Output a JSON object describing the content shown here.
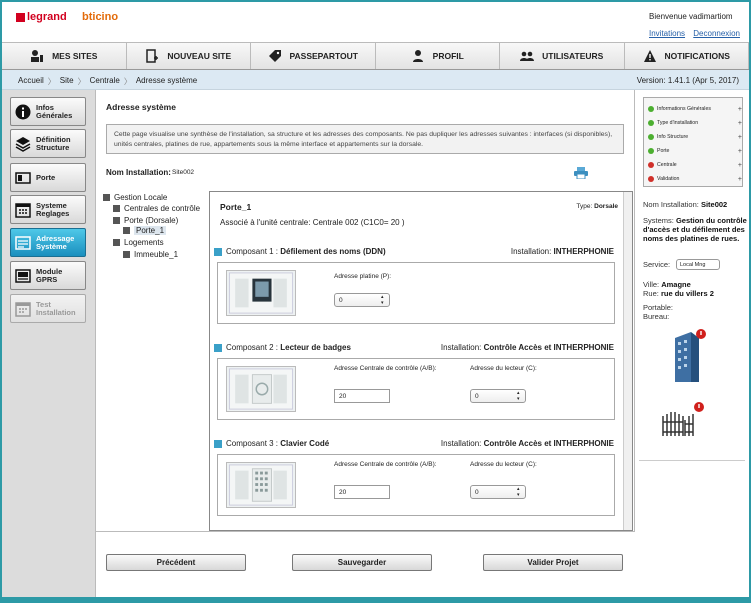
{
  "header": {
    "welcome": "Bienvenue vadimartiom",
    "invitations": "Invitations",
    "deconnexion": "Deconnexion",
    "brand1": "legrand",
    "brand2": "bticino"
  },
  "nav": [
    {
      "label": "MES SITES",
      "icon": "user-sites-icon"
    },
    {
      "label": "NOUVEAU SITE",
      "icon": "new-site-icon"
    },
    {
      "label": "PASSEPARTOUT",
      "icon": "tag-icon"
    },
    {
      "label": "PROFIL",
      "icon": "profile-icon"
    },
    {
      "label": "UTILISATEURS",
      "icon": "users-icon"
    },
    {
      "label": "NOTIFICATIONS",
      "icon": "warning-icon"
    }
  ],
  "breadcrumb": [
    "Accueil",
    "Site",
    "Centrale",
    "Adresse système"
  ],
  "version": "Version: 1.41.1 (Apr 5, 2017)",
  "sidebar": [
    {
      "label": "Infos Générales",
      "icon": "info-icon"
    },
    {
      "label": "Définition Structure",
      "icon": "layers-icon"
    },
    {
      "label": "Porte",
      "icon": "door-icon"
    },
    {
      "label": "Systeme Reglages",
      "icon": "calendar-icon"
    },
    {
      "label": "Adressage Système",
      "icon": "address-icon",
      "active": true
    },
    {
      "label": "Module GPRS",
      "icon": "gprs-icon"
    },
    {
      "label": "Test Installation",
      "icon": "test-icon",
      "disabled": true
    }
  ],
  "main": {
    "title": "Adresse système",
    "info": "Cette page visualise une synthèse de l'installation, sa structure et les adresses des composants. Ne pas dupliquer les adresses suivantes : interfaces (si disponibles), unités centrales, platines de rue, appartements sous la même interface et appartements sur la dorsale.",
    "nom_label": "Nom Installation:",
    "nom_value": "Site002"
  },
  "tree": [
    {
      "label": "Gestion Locale"
    },
    {
      "label": "Centrales de contrôle"
    },
    {
      "label": "Porte (Dorsale)"
    },
    {
      "label": "Porte_1"
    },
    {
      "label": "Logements"
    },
    {
      "label": "Immeuble_1"
    }
  ],
  "detail": {
    "name": "Porte_1",
    "type_label": "Type:",
    "type_value": "Dorsale",
    "assoc": "Associé à l'unité centrale: Centrale 002 (C1C0= 20 )",
    "components": [
      {
        "title": "Composant 1 :",
        "name": "Défilement des noms (DDN)",
        "inst_label": "Installation:",
        "inst_value": "INTHERPHONIE",
        "f1_label": "Adresse platine (P):",
        "f1_value": "0"
      },
      {
        "title": "Composant 2 :",
        "name": "Lecteur de badges",
        "inst_label": "Installation:",
        "inst_value": "Contrôle Accès et INTHERPHONIE",
        "f1_label": "Adresse Centrale de contrôle (A/B):",
        "f1_value": "20",
        "f2_label": "Adresse du lecteur (C):",
        "f2_value": "0"
      },
      {
        "title": "Composant 3 :",
        "name": "Clavier Codé",
        "inst_label": "Installation:",
        "inst_value": "Contrôle Accès et INTHERPHONIE",
        "f1_label": "Adresse Centrale de contrôle (A/B):",
        "f1_value": "20",
        "f2_label": "Adresse du lecteur (C):",
        "f2_value": "0"
      }
    ]
  },
  "footer": {
    "prev": "Précédent",
    "save": "Sauvegarder",
    "validate": "Valider Projet"
  },
  "status": [
    {
      "label": "Informations Générales",
      "color": "#4caf30"
    },
    {
      "label": "Type d'installation",
      "color": "#4caf30"
    },
    {
      "label": "Info Structure",
      "color": "#4caf30"
    },
    {
      "label": "Porte",
      "color": "#4caf30"
    },
    {
      "label": "Centrale",
      "color": "#d0302a"
    },
    {
      "label": "Validation",
      "color": "#d0302a"
    }
  ],
  "right": {
    "nom_label": "Nom Installation:",
    "nom_value": "Site002",
    "systems_label": "Systems:",
    "systems_value": "Gestion du contrôle d'accès et du défilement des noms des platines de rues.",
    "service_label": "Service:",
    "service_value": "Local Mng",
    "ville_label": "Ville:",
    "ville_value": "Amagne",
    "rue_label": "Rue:",
    "rue_value": "rue du villers 2",
    "portable_label": "Portable:",
    "bureau_label": "Bureau:"
  }
}
